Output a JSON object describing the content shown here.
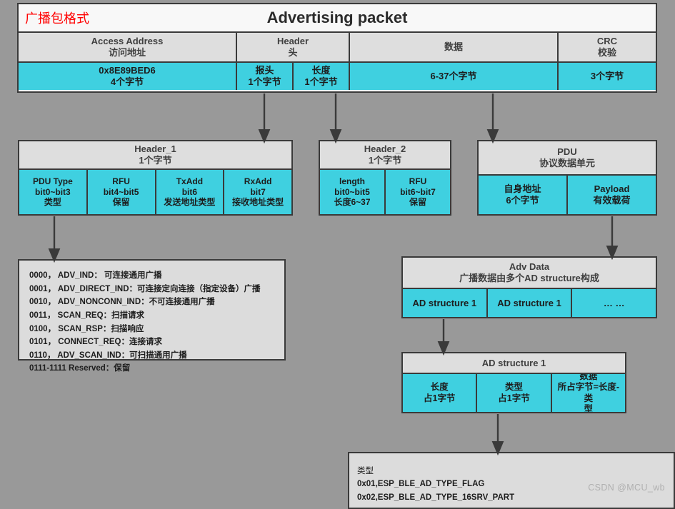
{
  "packet": {
    "tag": "广播包格式",
    "title": "Advertising packet",
    "columns": [
      {
        "name_en": "Access Address",
        "name_cn": "访问地址"
      },
      {
        "name_en": "Header",
        "name_cn": "头"
      },
      {
        "name_en": "",
        "name_cn": "数据"
      },
      {
        "name_en": "CRC",
        "name_cn": "校验"
      }
    ],
    "values": [
      {
        "v1": "0x8E89BED6",
        "v2": "4个字节"
      },
      {
        "v1": "报头",
        "v2": "1个字节"
      },
      {
        "v1": "长度",
        "v2": "1个字节"
      },
      {
        "v1": "6-37个字节",
        "v2": ""
      },
      {
        "v1": "3个字节",
        "v2": ""
      }
    ]
  },
  "header1": {
    "title": "Header_1",
    "subtitle": "1个字节",
    "fields": [
      {
        "l1": "PDU Type",
        "l2": "bit0~bit3",
        "l3": "类型"
      },
      {
        "l1": "RFU",
        "l2": "bit4~bit5",
        "l3": "保留"
      },
      {
        "l1": "TxAdd",
        "l2": "bit6",
        "l3": "发送地址类型"
      },
      {
        "l1": "RxAdd",
        "l2": "bit7",
        "l3": "接收地址类型"
      }
    ]
  },
  "header2": {
    "title": "Header_2",
    "subtitle": "1个字节",
    "fields": [
      {
        "l1": "length",
        "l2": "bit0~bit5",
        "l3": "长度6~37"
      },
      {
        "l1": "RFU",
        "l2": "bit6~bit7",
        "l3": "保留"
      }
    ]
  },
  "pdu": {
    "title": "PDU",
    "subtitle": "协议数据单元",
    "fields": [
      {
        "l1": "自身地址",
        "l2": "6个字节"
      },
      {
        "l1": "Payload",
        "l2": "有效载荷"
      }
    ]
  },
  "pdu_types": [
    "0000， ADV_IND： 可连接通用广播",
    "0001， ADV_DIRECT_IND：可连接定向连接（指定设备）广播",
    "0010， ADV_NONCONN_IND：不可连接通用广播",
    "0011， SCAN_REQ：扫描请求",
    "0100， SCAN_RSP：扫描响应",
    "0101， CONNECT_REQ：连接请求",
    "0110， ADV_SCAN_IND：可扫描通用广播",
    "0111-1111 Reserved：保留"
  ],
  "adv_data": {
    "title": "Adv Data",
    "subtitle": "广播数据由多个AD structure构成",
    "cells": [
      "AD structure 1",
      "AD structure 1",
      "… …"
    ]
  },
  "ad_structure": {
    "title": "AD structure 1",
    "fields": [
      {
        "l1": "长度",
        "l2": "占1字节",
        "l3": ""
      },
      {
        "l1": "类型",
        "l2": "占1字节",
        "l3": ""
      },
      {
        "l1": "数据",
        "l2": "所占字节=长度-类",
        "l3": "型"
      }
    ]
  },
  "ad_types": {
    "heading": "类型",
    "lines": [
      "0x01,ESP_BLE_AD_TYPE_FLAG",
      "0x02,ESP_BLE_AD_TYPE_16SRV_PART"
    ]
  },
  "watermark": "CSDN @MCU_wb",
  "colors": {
    "background": "#999999",
    "cell_fill": "#3fd0e0",
    "header_fill": "#dedede",
    "border": "#3a3a3a",
    "tag_text": "#ff0000"
  }
}
